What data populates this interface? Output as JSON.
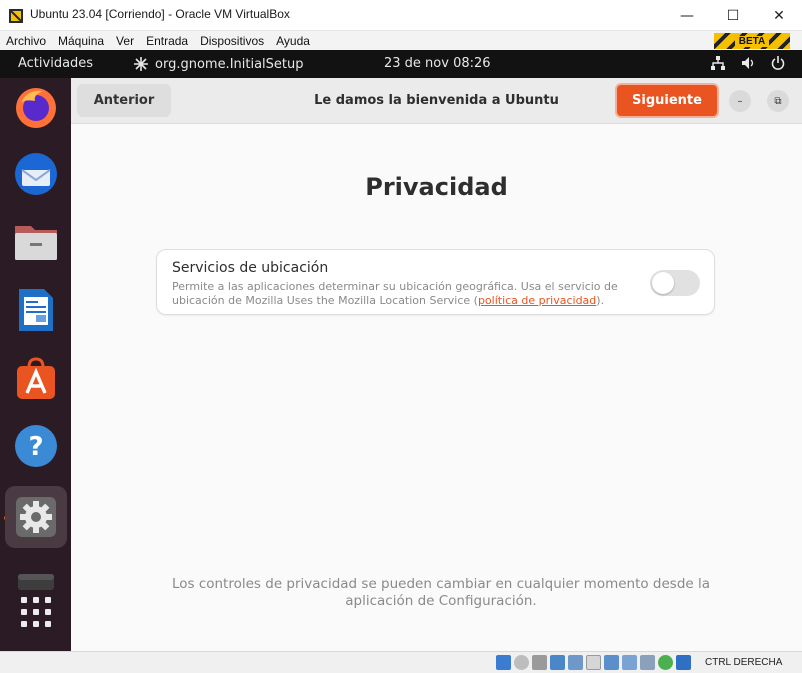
{
  "window": {
    "title": "Ubuntu 23.04 [Corriendo] - Oracle VM VirtualBox",
    "controls": {
      "minimize": "—",
      "maximize": "☐",
      "close": "✕"
    }
  },
  "menubar": {
    "items": [
      "Archivo",
      "Máquina",
      "Ver",
      "Entrada",
      "Dispositivos",
      "Ayuda"
    ],
    "badge": "BETA"
  },
  "topbar": {
    "activities": "Actividades",
    "app_name": "org.gnome.InitialSetup",
    "clock": "23 de nov  08:26",
    "tray_icons": [
      "network-icon",
      "volume-icon",
      "power-icon"
    ]
  },
  "dock": {
    "apps": [
      "firefox-icon",
      "thunderbird-icon",
      "files-icon",
      "writer-icon",
      "app-center-icon",
      "help-icon",
      "settings-icon",
      "drive-icon",
      "app-grid-icon"
    ]
  },
  "header": {
    "prev_label": "Anterior",
    "title": "Le damos la bienvenida a Ubuntu",
    "next_label": "Siguiente",
    "minimize_symbol": "–",
    "restore_symbol": "⧉"
  },
  "page": {
    "title": "Privacidad",
    "location_card": {
      "title": "Servicios de ubicación",
      "desc_before": "Permite a las aplicaciones determinar su ubicación geográfica. Usa el servicio de ubicación de Mozilla Uses the Mozilla Location Service (",
      "desc_link": "política de privacidad",
      "desc_after": ").",
      "enabled": false
    },
    "footer_note": "Los controles de privacidad se pueden cambiar en cualquier momento desde la aplicación de Configuración."
  },
  "statusbar": {
    "host_key": "CTRL DERECHA"
  },
  "colors": {
    "accent": "#e95420",
    "dock_bg": "#2b1b24",
    "topbar_bg": "#121212"
  }
}
